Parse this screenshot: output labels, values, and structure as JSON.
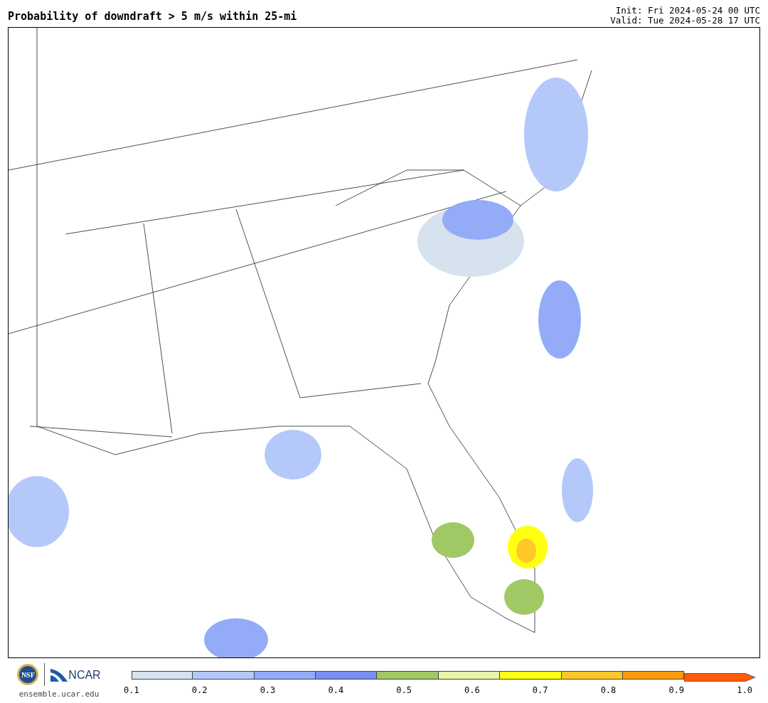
{
  "title": "Probability of downdraft > 5 m/s within 25-mi",
  "init": "Init: Fri 2024-05-24 00 UTC",
  "valid": "Valid: Tue 2024-05-28 17 UTC",
  "logos": [
    {
      "kind": "nsf",
      "text": "NSF"
    },
    {
      "kind": "ncar",
      "text": "NCAR"
    }
  ],
  "site": "ensemble.ucar.edu",
  "colorbar": {
    "segments": [
      {
        "color": "#d6e2ee"
      },
      {
        "color": "#b4c8fa"
      },
      {
        "color": "#94abf8"
      },
      {
        "color": "#7a8ff4"
      },
      {
        "color": "#a0c864"
      },
      {
        "color": "#e6f5a8"
      },
      {
        "color": "#ffff14"
      },
      {
        "color": "#ffc828"
      },
      {
        "color": "#ff9b0a"
      },
      {
        "color": "#ff5a0a"
      }
    ],
    "ticks": [
      "0.1",
      "0.2",
      "0.3",
      "0.4",
      "0.5",
      "0.6",
      "0.7",
      "0.8",
      "0.9",
      "1.0"
    ]
  }
}
